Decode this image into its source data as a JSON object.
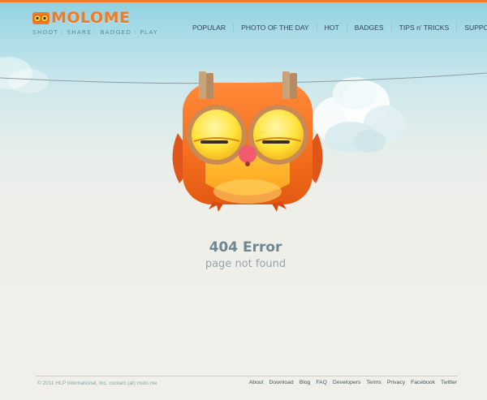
{
  "brand": {
    "name": "MOLOME",
    "tagline": "SHOOT : SHARE : BADGED : PLAY",
    "accent_color": "#f27a22",
    "logo_icon": "owl-logo-icon"
  },
  "nav": {
    "items": [
      {
        "label": "POPULAR"
      },
      {
        "label": "PHOTO OF THE DAY"
      },
      {
        "label": "HOT"
      },
      {
        "label": "BADGES"
      },
      {
        "label": "TIPS n' TRICKS"
      },
      {
        "label": "SUPPORT"
      }
    ]
  },
  "error": {
    "title": "404 Error",
    "subtitle": "page not found",
    "illustration": "sleepy-owl-illustration"
  },
  "footer": {
    "copyright": "© 2011 HLP International, Inc. contact (at) molo.me",
    "links": [
      {
        "label": "About"
      },
      {
        "label": "Download"
      },
      {
        "label": "Blog"
      },
      {
        "label": "FAQ"
      },
      {
        "label": "Developers"
      },
      {
        "label": "Terms"
      },
      {
        "label": "Privacy"
      },
      {
        "label": "Facebook"
      },
      {
        "label": "Twitter"
      }
    ]
  }
}
